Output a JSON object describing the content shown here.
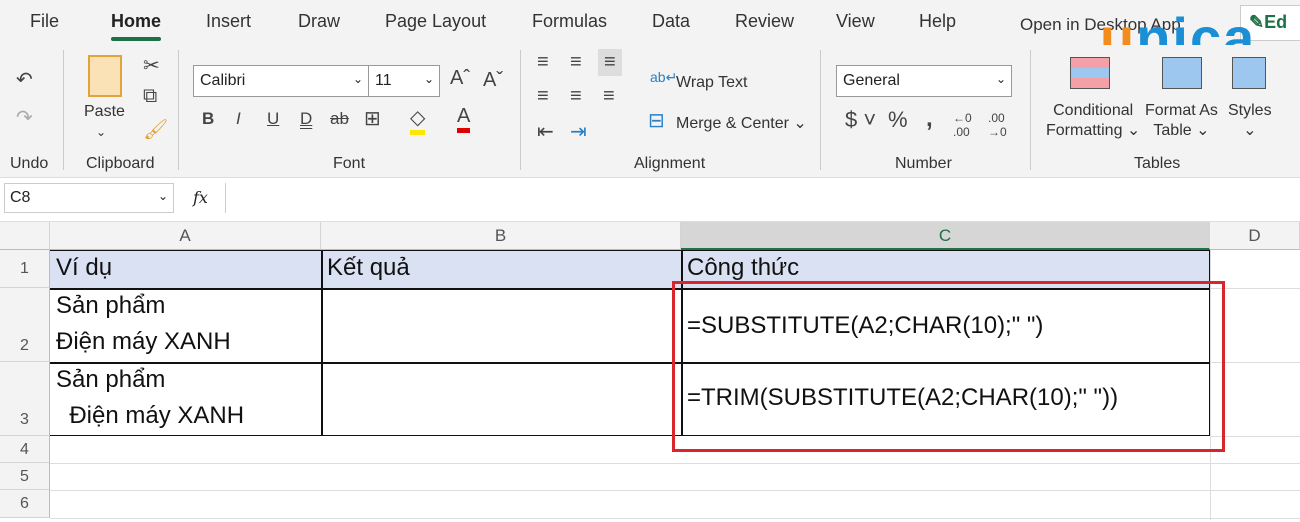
{
  "tabs": [
    "File",
    "Home",
    "Insert",
    "Draw",
    "Page Layout",
    "Formulas",
    "Data",
    "Review",
    "View",
    "Help"
  ],
  "open_desktop": "Open in Desktop App",
  "edit_label": "Ed",
  "watermark": "unica",
  "ribbon": {
    "undo_group": "Undo",
    "clipboard_group": "Clipboard",
    "paste": "Paste",
    "font_group": "Font",
    "font_name": "Calibri",
    "font_size": "11",
    "alignment_group": "Alignment",
    "wrap_text": "Wrap Text",
    "merge_center": "Merge & Center",
    "number_format": "General",
    "number_group": "Number",
    "conditional_1": "Conditional",
    "conditional_2": "Formatting",
    "format_as_1": "Format As",
    "format_as_2": "Table",
    "styles": "Styles",
    "tables_group": "Tables",
    "bold": "B",
    "italic": "I",
    "underline": "U",
    "double_underline": "D",
    "strike": "ab"
  },
  "name_box": "C8",
  "fx": "fx",
  "formula": "",
  "columns": [
    "A",
    "B",
    "C",
    "D"
  ],
  "rows": [
    "1",
    "2",
    "3",
    "4",
    "5",
    "6"
  ],
  "cells": {
    "A1": "Ví dụ",
    "B1": "Kết quả",
    "C1": "Công thức",
    "A2_l1": "Sản phẩm",
    "A2_l2": "Điện máy XANH",
    "C2": "=SUBSTITUTE(A2;CHAR(10);\" \")",
    "A3_l1": "Sản phẩm",
    "A3_l2": "  Điện máy XANH",
    "C3": "=TRIM(SUBSTITUTE(A2;CHAR(10);\" \"))"
  },
  "colors": {
    "accent": "#1e7145",
    "header_fill": "#d9e1f2",
    "highlight_box": "#d9262c"
  }
}
